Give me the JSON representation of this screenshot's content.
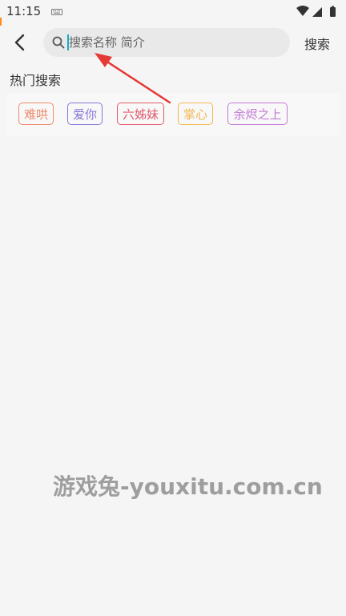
{
  "status_bar": {
    "time": "11:15",
    "icons": [
      "keyboard-icon",
      "wifi-icon",
      "signal-icon",
      "battery-icon"
    ]
  },
  "header": {
    "back_icon": "chevron-left-icon",
    "search": {
      "placeholder": "搜索名称 简介",
      "value": "",
      "icon": "search-icon"
    },
    "search_button_label": "搜索"
  },
  "hot_search": {
    "title": "热门搜索",
    "tags": [
      {
        "label": "难哄",
        "color": "#ef8a6a"
      },
      {
        "label": "爱你",
        "color": "#8a76d6"
      },
      {
        "label": "六姊妹",
        "color": "#e05a6a"
      },
      {
        "label": "掌心",
        "color": "#f2b652"
      },
      {
        "label": "余烬之上",
        "color": "#c47ad6"
      }
    ]
  },
  "annotation": {
    "color": "#e53935"
  },
  "watermark": "游戏兔-youxitu.com.cn"
}
